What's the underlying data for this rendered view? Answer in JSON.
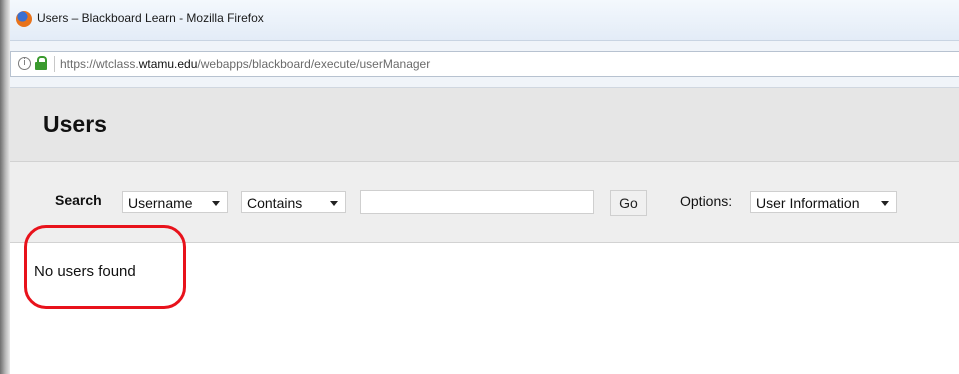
{
  "window": {
    "title": "Users – Blackboard Learn - Mozilla Firefox"
  },
  "address_bar": {
    "url_prefix": "https://wtclass.",
    "url_host": "wtamu.edu",
    "url_path": "/webapps/blackboard/execute/userManager"
  },
  "page": {
    "title": "Users",
    "search": {
      "label": "Search",
      "field_select": "Username",
      "operator_select": "Contains",
      "query_value": "",
      "go_label": "Go",
      "options_label": "Options:",
      "options_select": "User Information"
    },
    "result_message": "No users found"
  },
  "annotation": {
    "highlight_color": "#e8121b"
  }
}
